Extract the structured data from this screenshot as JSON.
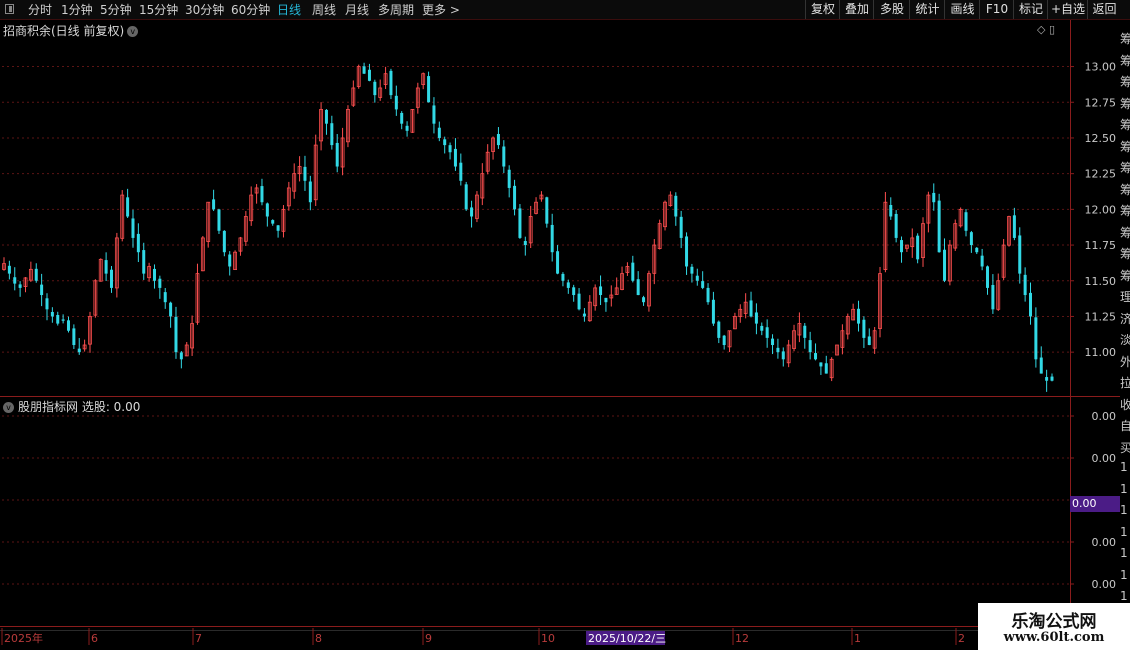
{
  "toolbar": {
    "periods": [
      "分时",
      "1分钟",
      "5分钟",
      "15分钟",
      "30分钟",
      "60分钟",
      "日线",
      "周线",
      "月线",
      "多周期",
      "更多 >"
    ],
    "active_period": "日线",
    "right_buttons": [
      "复权",
      "叠加",
      "多股",
      "统计",
      "画线",
      "F10",
      "标记",
      "+自选",
      "返回"
    ]
  },
  "main": {
    "title": "招商积余(日线 前复权)",
    "circle_glyph": "v",
    "corner_icons": "◇ ▯"
  },
  "indicator": {
    "title": "股朋指标网  选股: 0.00",
    "selected_value": "0.00",
    "axis_labels": [
      "0.00",
      "0.00",
      "0.00",
      "0.00",
      "0.00"
    ]
  },
  "date_axis": {
    "labels": [
      "2025年",
      "6",
      "7",
      "8",
      "9",
      "10",
      "12",
      "1",
      "2"
    ],
    "cursor_label": "2025/10/22/三"
  },
  "right_strip": {
    "chars": [
      "筹",
      "筹",
      "筹",
      "筹",
      "筹",
      "筹",
      "筹",
      "筹",
      "筹",
      "筹",
      "筹",
      "筹",
      "理",
      "济",
      "淡",
      "外",
      "拉",
      "收",
      "自",
      "买",
      "1",
      "1",
      "1",
      "1",
      "1",
      "1",
      "1",
      "1"
    ]
  },
  "logo": {
    "line1": "乐淘公式网",
    "line2": "www.60lt.com"
  },
  "colors": {
    "up": "#ff4f4f",
    "down": "#32d9e6",
    "grid": "#5c1414",
    "axis": "#8a1c1c",
    "highlight": "#4b1c86"
  },
  "chart_data": {
    "type": "candlestick",
    "title": "招商积余(日线 前复权)",
    "price_axis_ticks": [
      13.0,
      12.75,
      12.5,
      12.25,
      12.0,
      11.75,
      11.5,
      11.25,
      11.0
    ],
    "ylim": [
      10.7,
      13.2
    ],
    "indicator_axis_ticks": [
      0.0,
      0.0,
      0.0,
      0.0,
      0.0
    ],
    "closes": [
      11.62,
      11.55,
      11.48,
      11.45,
      11.52,
      11.58,
      11.5,
      11.4,
      11.3,
      11.25,
      11.2,
      11.22,
      11.15,
      11.05,
      11.0,
      11.05,
      11.25,
      11.5,
      11.65,
      11.55,
      11.45,
      11.8,
      12.1,
      11.95,
      11.8,
      11.7,
      11.55,
      11.6,
      11.5,
      11.45,
      11.35,
      11.25,
      11.0,
      10.95,
      11.05,
      11.2,
      11.55,
      11.8,
      12.05,
      12.0,
      11.85,
      11.7,
      11.6,
      11.7,
      11.8,
      11.95,
      12.1,
      12.15,
      12.05,
      11.95,
      11.9,
      11.85,
      12.0,
      12.15,
      12.25,
      12.3,
      12.2,
      12.05,
      12.45,
      12.7,
      12.6,
      12.45,
      12.3,
      12.5,
      12.7,
      12.85,
      13.0,
      12.95,
      12.9,
      12.8,
      12.85,
      12.95,
      12.8,
      12.7,
      12.6,
      12.55,
      12.7,
      12.85,
      12.95,
      12.75,
      12.6,
      12.5,
      12.45,
      12.4,
      12.3,
      12.2,
      12.0,
      11.95,
      12.1,
      12.25,
      12.4,
      12.5,
      12.45,
      12.3,
      12.15,
      12.0,
      11.8,
      11.75,
      11.95,
      12.05,
      12.1,
      11.9,
      11.7,
      11.55,
      11.5,
      11.45,
      11.4,
      11.3,
      11.25,
      11.35,
      11.45,
      11.4,
      11.35,
      11.4,
      11.45,
      11.55,
      11.6,
      11.5,
      11.4,
      11.35,
      11.55,
      11.75,
      11.9,
      12.05,
      12.1,
      11.95,
      11.8,
      11.6,
      11.55,
      11.5,
      11.45,
      11.35,
      11.2,
      11.1,
      11.05,
      11.15,
      11.25,
      11.3,
      11.35,
      11.25,
      11.2,
      11.15,
      11.1,
      11.05,
      11.0,
      10.95,
      11.05,
      11.15,
      11.2,
      11.1,
      11.0,
      10.95,
      10.9,
      10.85,
      10.95,
      11.05,
      11.15,
      11.25,
      11.3,
      11.2,
      11.1,
      11.05,
      11.15,
      11.55,
      12.05,
      11.95,
      11.8,
      11.7,
      11.75,
      11.8,
      11.65,
      11.9,
      12.1,
      12.05,
      11.7,
      11.5,
      11.75,
      11.9,
      12.0,
      11.85,
      11.75,
      11.7,
      11.6,
      11.45,
      11.3,
      11.5,
      11.75,
      11.95,
      11.8,
      11.55,
      11.4,
      11.25,
      10.95,
      10.85,
      10.8,
      10.8
    ]
  }
}
